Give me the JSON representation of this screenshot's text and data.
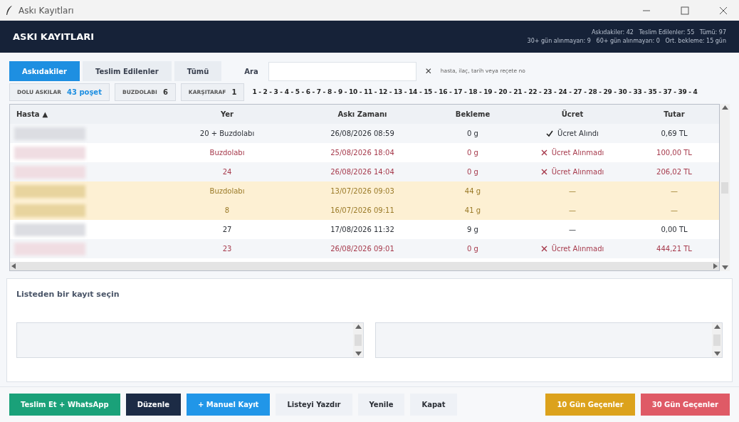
{
  "window": {
    "title": "Askı Kayıtları"
  },
  "header": {
    "title": "ASKI KAYITLARI",
    "stats_line_1": "Askıdakiler: 42   Teslim Edilenler: 55   Tümü: 97",
    "stats_line_2": "30+ gün alınmayan: 9   60+ gün alınmayan: 0   Ort. bekleme: 15 gün"
  },
  "tabs": [
    {
      "label": "Askıdakiler",
      "selected": true
    },
    {
      "label": "Teslim Edilenler",
      "selected": false
    },
    {
      "label": "Tümü",
      "selected": false
    }
  ],
  "search": {
    "label": "Ara",
    "clear": "✕",
    "hint": "hasta, ilaç, tarih veya reçete no"
  },
  "chips": [
    {
      "label": "DOLU ASKILAR",
      "value": "43 poşet",
      "kind": "accent"
    },
    {
      "label": "BUZDOLABI",
      "value": "6",
      "kind": "plain"
    },
    {
      "label": "KARŞITARAF",
      "value": "1",
      "kind": "plain"
    }
  ],
  "shelf_numbers": "1 - 2 - 3 - 4 - 5 - 6 - 7 - 8 - 9 - 10 - 11 - 12 - 13 - 14 - 15 - 16 - 17 - 18 - 19 - 20 - 21 - 22 - 23 - 24 - 27 - 28 - 29 - 30 - 33 - 35 - 37 - 39 - 4",
  "table": {
    "columns": [
      {
        "label": "Hasta",
        "sort": "▲"
      },
      {
        "label": "Yer"
      },
      {
        "label": "Askı Zamanı"
      },
      {
        "label": "Bekleme"
      },
      {
        "label": "Ücret"
      },
      {
        "label": "Tutar"
      }
    ],
    "rows": [
      {
        "kind": "normal",
        "yer": "20 + Buzdolabı",
        "zaman": "26/08/2026 08:59",
        "bekleme": "0 g",
        "ucret": {
          "kind": "paid",
          "label": "Ücret Alındı"
        },
        "tutar": "0,69 TL"
      },
      {
        "kind": "unpaid",
        "yer": "Buzdolabı",
        "zaman": "25/08/2026 18:04",
        "bekleme": "0 g",
        "ucret": {
          "kind": "unpaid",
          "label": "Ücret Alınmadı"
        },
        "tutar": "100,00 TL"
      },
      {
        "kind": "unpaid",
        "yer": "24",
        "zaman": "26/08/2026 14:04",
        "bekleme": "0 g",
        "ucret": {
          "kind": "unpaid",
          "label": "Ücret Alınmadı"
        },
        "tutar": "206,02 TL"
      },
      {
        "kind": "overdue",
        "yer": "Buzdolabı",
        "zaman": "13/07/2026 09:03",
        "bekleme": "44 g",
        "ucret": {
          "kind": "none",
          "label": "—"
        },
        "tutar": "—"
      },
      {
        "kind": "overdue",
        "yer": "8",
        "zaman": "16/07/2026 09:11",
        "bekleme": "41 g",
        "ucret": {
          "kind": "none",
          "label": "—"
        },
        "tutar": "—"
      },
      {
        "kind": "normal",
        "yer": "27",
        "zaman": "17/08/2026 11:32",
        "bekleme": "9 g",
        "ucret": {
          "kind": "none",
          "label": "—"
        },
        "tutar": "0,00 TL"
      },
      {
        "kind": "unpaid",
        "yer": "23",
        "zaman": "26/08/2026 09:01",
        "bekleme": "0 g",
        "ucret": {
          "kind": "unpaid",
          "label": "Ücret Alınmadı"
        },
        "tutar": "444,21 TL"
      }
    ]
  },
  "detail": {
    "title": "Listeden bir kayıt seçin"
  },
  "buttons_left": [
    {
      "label": "Teslim Et + WhatsApp",
      "color": "#1aa179"
    },
    {
      "label": "Düzenle",
      "color": "#1c2b45"
    },
    {
      "label": "+ Manuel Kayıt",
      "color": "#2196e8"
    },
    {
      "label": "Listeyi Yazdır",
      "color": "#eef1f6"
    },
    {
      "label": "Yenile",
      "color": "#eef1f6"
    },
    {
      "label": "Kapat",
      "color": "#eef1f6"
    }
  ],
  "buttons_right": [
    {
      "label": "10 Gün Geçenler",
      "color": "#dca21c"
    },
    {
      "label": "30 Gün Geçenler",
      "color": "#df5a66"
    }
  ]
}
